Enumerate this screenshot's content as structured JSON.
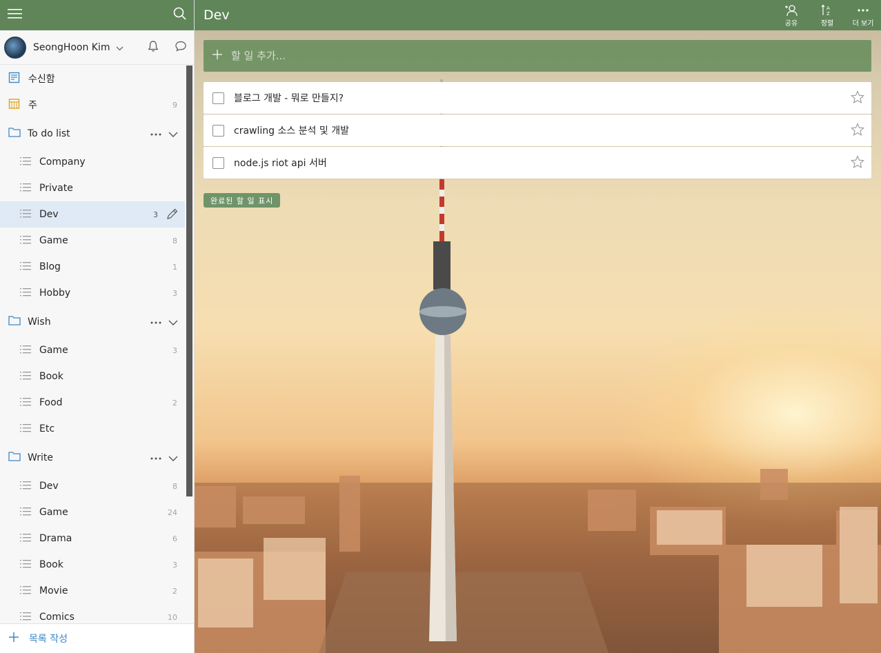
{
  "sidebar": {
    "user": {
      "name": "SeongHoon Kim"
    },
    "smart_lists": [
      {
        "label": "수신함",
        "icon": "inbox-icon",
        "count": ""
      },
      {
        "label": "주",
        "icon": "calendar-week-icon",
        "count": "9"
      }
    ],
    "folders": [
      {
        "label": "To do list",
        "lists": [
          {
            "label": "Company",
            "count": ""
          },
          {
            "label": "Private",
            "count": ""
          },
          {
            "label": "Dev",
            "count": "3",
            "active": true
          },
          {
            "label": "Game",
            "count": "8"
          },
          {
            "label": "Blog",
            "count": "1"
          },
          {
            "label": "Hobby",
            "count": "3"
          }
        ]
      },
      {
        "label": "Wish",
        "lists": [
          {
            "label": "Game",
            "count": "3"
          },
          {
            "label": "Book",
            "count": ""
          },
          {
            "label": "Food",
            "count": "2"
          },
          {
            "label": "Etc",
            "count": ""
          }
        ]
      },
      {
        "label": "Write",
        "lists": [
          {
            "label": "Dev",
            "count": "8"
          },
          {
            "label": "Game",
            "count": "24"
          },
          {
            "label": "Drama",
            "count": "6"
          },
          {
            "label": "Book",
            "count": "3"
          },
          {
            "label": "Movie",
            "count": "2"
          },
          {
            "label": "Comics",
            "count": "10"
          }
        ]
      }
    ],
    "create_list_label": "목록 작성"
  },
  "main": {
    "list_title": "Dev",
    "actions": [
      {
        "label": "공유",
        "icon": "share-person-icon"
      },
      {
        "label": "정렬",
        "icon": "sort-az-icon"
      },
      {
        "label": "더 보기",
        "icon": "more-icon"
      }
    ],
    "add_placeholder": "할 일 추가...",
    "tasks": [
      {
        "title": "블로그 개발 - 뭐로 만들지?"
      },
      {
        "title": "crawling 소스 분석 및 개발"
      },
      {
        "title": "node.js riot api 서버"
      }
    ],
    "show_completed_label": "완료된 할 일 표시"
  },
  "colors": {
    "header_green": "#5f8558",
    "accent_blue": "#3b87c8",
    "active_row": "#dfeaf6"
  }
}
